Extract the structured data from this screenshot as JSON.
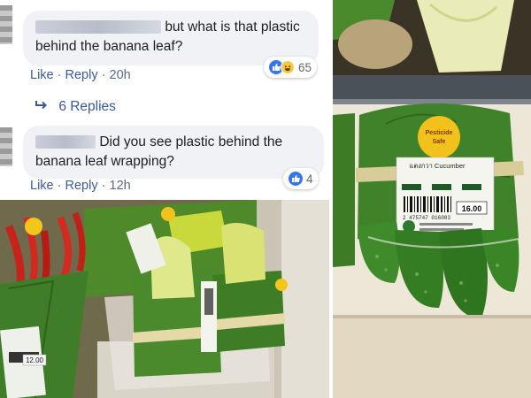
{
  "comment1": {
    "text_line1": "but what is that plastic",
    "text_line2": "behind the banana leaf?",
    "actions": {
      "like": "Like",
      "reply": "Reply",
      "time": "20h"
    },
    "reaction_count": "65",
    "replies_label": "6 Replies"
  },
  "comment2": {
    "text_line1": "Did you see plastic behind the",
    "text_line2": "banana leaf wrapping?",
    "actions": {
      "like": "Like",
      "reply": "Reply",
      "time": "12h"
    },
    "reaction_count": "4"
  },
  "photo_right": {
    "sticker_line1": "Pesticide",
    "sticker_line2": "Safe",
    "label_title": "แตงกวา Cucumber",
    "price": "16.00",
    "barcode_number": "2 475747 016003"
  },
  "photo_left": {
    "price": "12.00"
  },
  "separator": "·",
  "colors": {
    "link": "#385898",
    "bubble": "#f1f2f6",
    "like_blue": "#3578e5"
  }
}
